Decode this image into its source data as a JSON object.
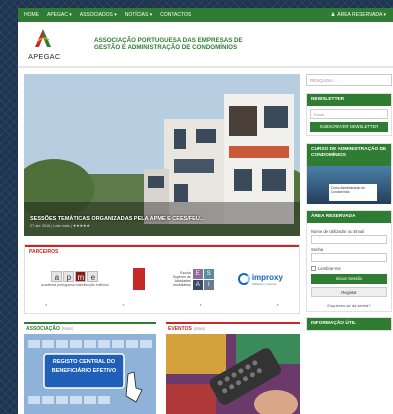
{
  "topbar": {
    "nav": [
      "HOME",
      "APEGAC ▾",
      "ASSOCIADOS ▾",
      "NOTÍCIAS ▾",
      "CONTACTOS"
    ],
    "reserved": "ÁREA RESERVADA ▾",
    "reserved_icon": "user-icon"
  },
  "header": {
    "logo_text": "APEGAC",
    "title_line1": "ASSOCIAÇÃO PORTUGUESA DAS EMPRESAS DE",
    "title_line2": "GESTÃO E ADMINISTRAÇÃO DE CONDOMÍNIOS"
  },
  "hero": {
    "caption": "SESSÕES TEMÁTICAS ORGANIZADAS PELA APME E CEES/FEU...",
    "meta": "27 abr 2016 | Leia mais | ★★★★★"
  },
  "partners": {
    "title": "PARCEIROS",
    "apme_letters": [
      "a",
      "p",
      "m",
      "e"
    ],
    "apme_sub": "academia portuguesa manutenção edifícios",
    "esai_text": "Escola Superior de Atividades Imobiliárias",
    "esai_letters": [
      "E",
      "S",
      "A",
      "I"
    ],
    "improxy_name": "improxy",
    "improxy_sub": "Software | Internet"
  },
  "cards": {
    "assoc_title": "ASSOCIAÇÃO",
    "assoc_more": "(Mais)",
    "assoc_sign_line1": "REGISTO CENTRAL DO",
    "assoc_sign_line2": "BENEFICIÁRIO EFETIVO",
    "events_title": "EVENTOS",
    "events_more": "(Mais)"
  },
  "sidebar": {
    "search_placeholder": "PESQUISA ...",
    "newsletter_title": "NEWSLETTER",
    "email_placeholder": "Email",
    "subscribe": "SUBSCREVER NEWSLETTER",
    "course_title": "CURSO DE ADMINISTRAÇÃO DE CONDOMÍNIOS",
    "course_sheet": "Curso Administração de Condomínios",
    "reserved_title": "ÁREA RESERVADA",
    "user_label": "Nome de Utilizador ou Email",
    "password_label": "Senha",
    "remember": "Lembrar-me",
    "login_btn": "Iniciar Sessão",
    "register_btn": "Registar",
    "forgot": "Esqueceu-se da senha?",
    "info_title": "INFORMAÇÃO ÚTIL"
  },
  "colors": {
    "green": "#2e7d32",
    "red": "#c62828",
    "bg": "#1e3552"
  }
}
